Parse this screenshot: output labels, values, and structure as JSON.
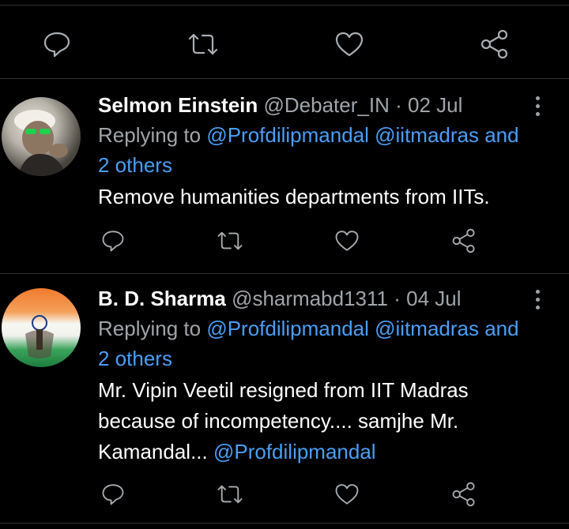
{
  "tweets": [
    {
      "name": "Selmon Einstein",
      "handle": "@Debater_IN",
      "separator": "·",
      "date": "02 Jul",
      "replying_prefix": "Replying to",
      "replying_mentions": "@Profdilipmandal @iitmadras and",
      "replying_others": "2 others",
      "text": "Remove humanities departments from IITs."
    },
    {
      "name": "B. D. Sharma",
      "handle": "@sharmabd1311",
      "separator": "·",
      "date": "04 Jul",
      "replying_prefix": "Replying to",
      "replying_mentions": "@Profdilipmandal @iitmadras and",
      "replying_others": "2 others",
      "text_line1": "Mr. Vipin Veetil resigned from IIT Madras",
      "text_line2": "because of incompetency.... samjhe Mr.",
      "text_line3_prefix": "Kamandal...",
      "text_line3_mention": "@Profdilipmandal"
    }
  ],
  "icons": {
    "reply": "reply-icon",
    "retweet": "retweet-icon",
    "like": "heart-icon",
    "share": "share-icon",
    "more": "more-vertical-icon"
  },
  "colors": {
    "background": "#000000",
    "link": "#4a9ff5",
    "muted": "#a0a5aa",
    "divider": "#2f3336"
  }
}
